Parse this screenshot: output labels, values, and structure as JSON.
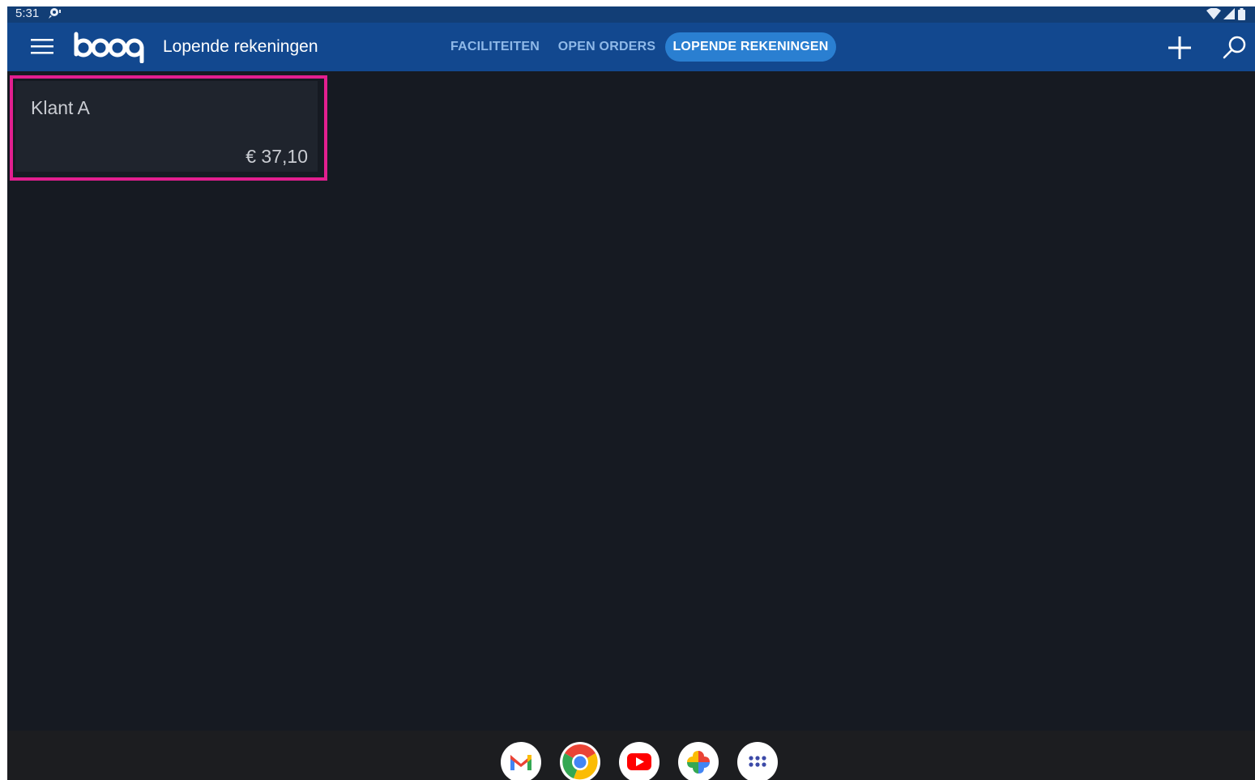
{
  "status_bar": {
    "time": "5:31",
    "icons": [
      "notification-icon",
      "wifi-icon",
      "signal-icon",
      "battery-icon"
    ]
  },
  "app_bar": {
    "menu_icon": "hamburger-menu-icon",
    "logo_text": "booq",
    "title": "Lopende rekeningen",
    "tabs": [
      {
        "label": "FACILITEITEN",
        "active": false
      },
      {
        "label": "OPEN ORDERS",
        "active": false
      },
      {
        "label": "LOPENDE REKENINGEN",
        "active": true
      }
    ],
    "actions": [
      "plus-icon",
      "search-icon"
    ]
  },
  "accounts": [
    {
      "name": "Klant A",
      "amount": "€ 37,10",
      "highlighted": true
    }
  ],
  "dock": {
    "apps": [
      "gmail-icon",
      "chrome-icon",
      "youtube-icon",
      "photos-icon",
      "app-drawer-icon"
    ]
  },
  "colors": {
    "status_bar": "#123e76",
    "app_bar": "#12488f",
    "active_tab": "#2a7fd1",
    "inactive_tab_text": "#8fb9e8",
    "background": "#161a22",
    "card": "#1f242d",
    "highlight": "#e21f8f"
  }
}
